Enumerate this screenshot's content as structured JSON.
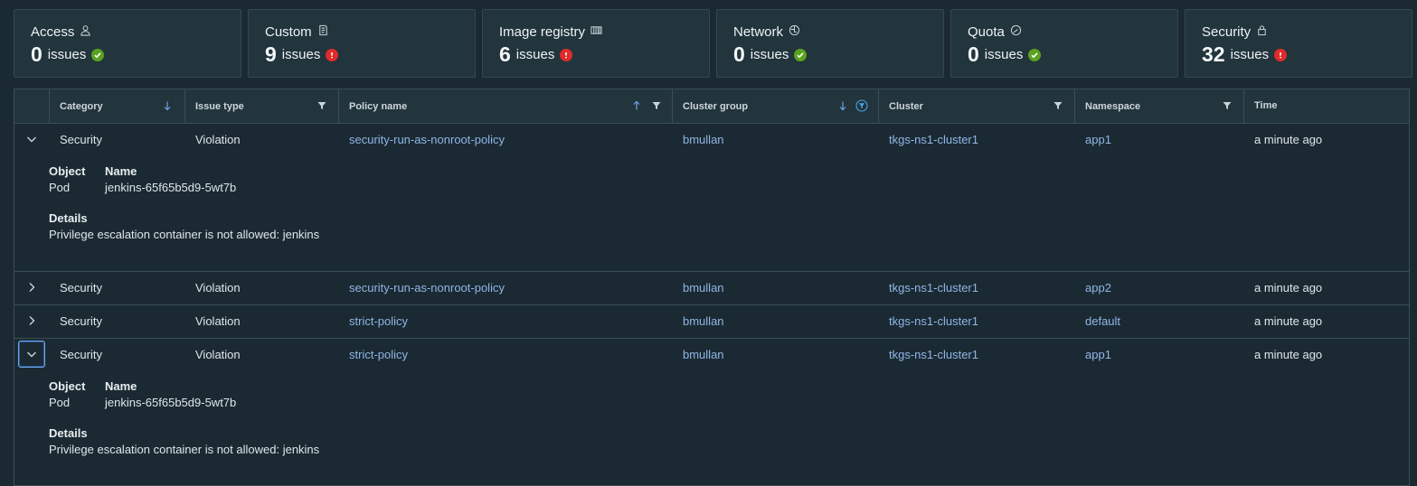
{
  "cards": [
    {
      "title": "Access",
      "icon": "user-icon",
      "count": "0",
      "label": "issues",
      "status": "ok"
    },
    {
      "title": "Custom",
      "icon": "document-icon",
      "count": "9",
      "label": "issues",
      "status": "error"
    },
    {
      "title": "Image registry",
      "icon": "registry-icon",
      "count": "6",
      "label": "issues",
      "status": "error"
    },
    {
      "title": "Network",
      "icon": "network-icon",
      "count": "0",
      "label": "issues",
      "status": "ok"
    },
    {
      "title": "Quota",
      "icon": "gauge-icon",
      "count": "0",
      "label": "issues",
      "status": "ok"
    },
    {
      "title": "Security",
      "icon": "lock-icon",
      "count": "32",
      "label": "issues",
      "status": "error"
    }
  ],
  "table": {
    "columns": {
      "category": "Category",
      "issue_type": "Issue type",
      "policy_name": "Policy name",
      "cluster_group": "Cluster group",
      "cluster": "Cluster",
      "namespace": "Namespace",
      "time": "Time"
    },
    "rows": [
      {
        "category": "Security",
        "issue_type": "Violation",
        "policy_name": "security-run-as-nonroot-policy",
        "cluster_group": "bmullan",
        "cluster": "tkgs-ns1-cluster1",
        "namespace": "app1",
        "time": "a minute ago"
      },
      {
        "category": "Security",
        "issue_type": "Violation",
        "policy_name": "security-run-as-nonroot-policy",
        "cluster_group": "bmullan",
        "cluster": "tkgs-ns1-cluster1",
        "namespace": "app2",
        "time": "a minute ago"
      },
      {
        "category": "Security",
        "issue_type": "Violation",
        "policy_name": "strict-policy",
        "cluster_group": "bmullan",
        "cluster": "tkgs-ns1-cluster1",
        "namespace": "default",
        "time": "a minute ago"
      },
      {
        "category": "Security",
        "issue_type": "Violation",
        "policy_name": "strict-policy",
        "cluster_group": "bmullan",
        "cluster": "tkgs-ns1-cluster1",
        "namespace": "app1",
        "time": "a minute ago"
      }
    ],
    "details": [
      {
        "object_label": "Object",
        "object_value": "Pod",
        "name_label": "Name",
        "name_value": "jenkins-65f65b5d9-5wt7b",
        "details_label": "Details",
        "details_value": "Privilege escalation container is not allowed: jenkins"
      },
      {
        "object_label": "Object",
        "object_value": "Pod",
        "name_label": "Name",
        "name_value": "jenkins-65f65b5d9-5wt7b",
        "details_label": "Details",
        "details_value": "Privilege escalation container is not allowed: jenkins"
      }
    ]
  },
  "colors": {
    "ok": "#5aa220",
    "error": "#e02b2b",
    "link": "#8fb5e8",
    "accent": "#4aa3e8"
  }
}
